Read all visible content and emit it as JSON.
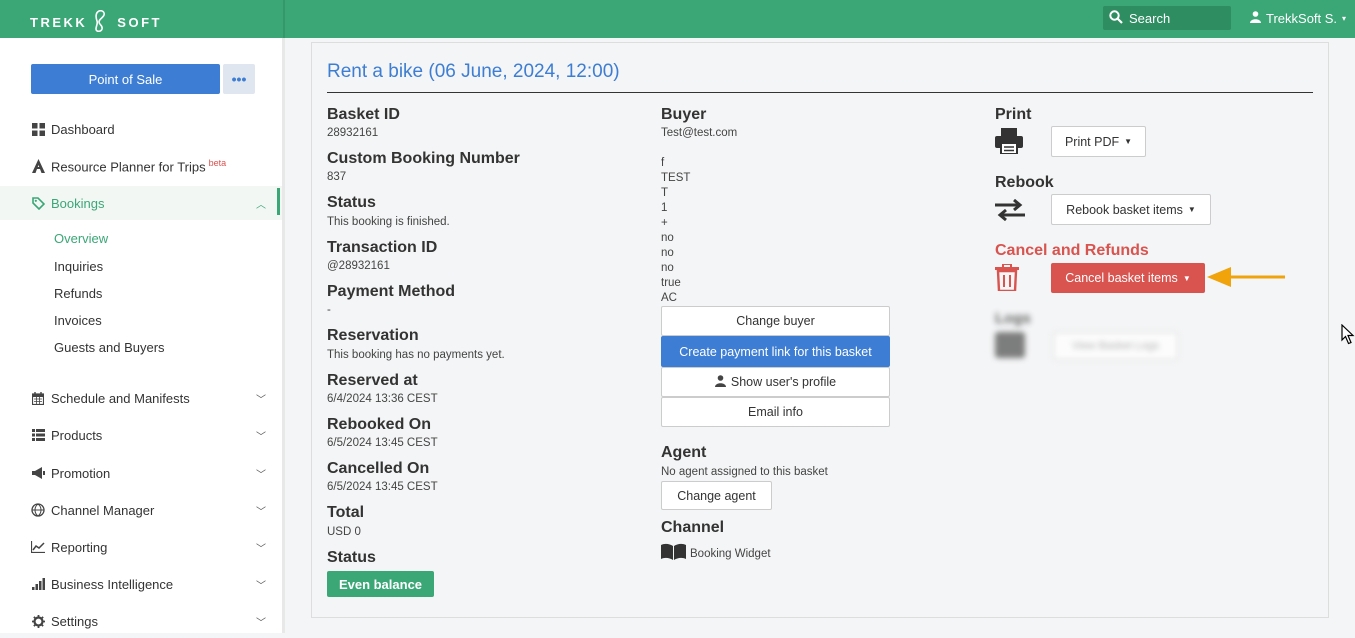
{
  "topbar": {
    "logo_left": "TREKK",
    "logo_right": "SOFT",
    "search_label": "Search",
    "user_label": "TrekkSoft S."
  },
  "sidebar": {
    "pos_button": "Point of Sale",
    "more_button": "•••",
    "items": [
      {
        "label": "Dashboard",
        "icon": "dashboard-icon"
      },
      {
        "label": "Resource Planner for Trips",
        "badge": "beta",
        "icon": "resource-icon"
      },
      {
        "label": "Bookings",
        "icon": "tag-icon"
      },
      {
        "label": "Schedule and Manifests",
        "icon": "calendar-icon"
      },
      {
        "label": "Products",
        "icon": "list-icon"
      },
      {
        "label": "Promotion",
        "icon": "megaphone-icon"
      },
      {
        "label": "Channel Manager",
        "icon": "globe-icon"
      },
      {
        "label": "Reporting",
        "icon": "chart-icon"
      },
      {
        "label": "Business Intelligence",
        "icon": "bars-icon"
      },
      {
        "label": "Settings",
        "icon": "gear-icon"
      }
    ],
    "sub_items": [
      "Overview",
      "Inquiries",
      "Refunds",
      "Invoices",
      "Guests and Buyers"
    ]
  },
  "main": {
    "title": "Rent a bike (06 June, 2024, 12:00)",
    "fields": [
      {
        "label": "Basket ID",
        "value": "28932161"
      },
      {
        "label": "Custom Booking Number",
        "value": "837"
      },
      {
        "label": "Status",
        "value": "This booking is finished."
      },
      {
        "label": "Transaction ID",
        "value": "@28932161"
      },
      {
        "label": "Payment Method",
        "value": "-"
      },
      {
        "label": "Reservation",
        "value": "This booking has no payments yet."
      },
      {
        "label": "Reserved at",
        "value": "6/4/2024 13:36 CEST"
      },
      {
        "label": "Rebooked On",
        "value": "6/5/2024 13:45 CEST"
      },
      {
        "label": "Cancelled On",
        "value": "6/5/2024 13:45 CEST"
      },
      {
        "label": "Total",
        "value": "USD 0"
      },
      {
        "label": "Status",
        "value": "Even balance"
      }
    ],
    "buyer": {
      "label": "Buyer",
      "email": "Test@test.com",
      "lines": [
        "f",
        "TEST",
        "T",
        "1",
        "+",
        "no",
        "no",
        "no",
        "true",
        "AC"
      ],
      "buttons": [
        "Change buyer",
        "Create payment link for this basket",
        "Show user's profile",
        "Email info"
      ]
    },
    "agent": {
      "label": "Agent",
      "value": "No agent assigned to this basket",
      "button": "Change agent"
    },
    "channel": {
      "label": "Channel",
      "value": "Booking Widget"
    },
    "actions": {
      "print_label": "Print",
      "print_button": "Print PDF",
      "rebook_label": "Rebook",
      "rebook_button": "Rebook basket items",
      "cancel_label": "Cancel and Refunds",
      "cancel_button": "Cancel basket items",
      "logs_label": "Logs",
      "logs_button": "View Basket Logs"
    }
  },
  "colors": {
    "brand_green": "#3ba776",
    "primary_blue": "#3d7dd3",
    "danger_red": "#d9534f",
    "arrow_orange": "#f0a30a"
  }
}
